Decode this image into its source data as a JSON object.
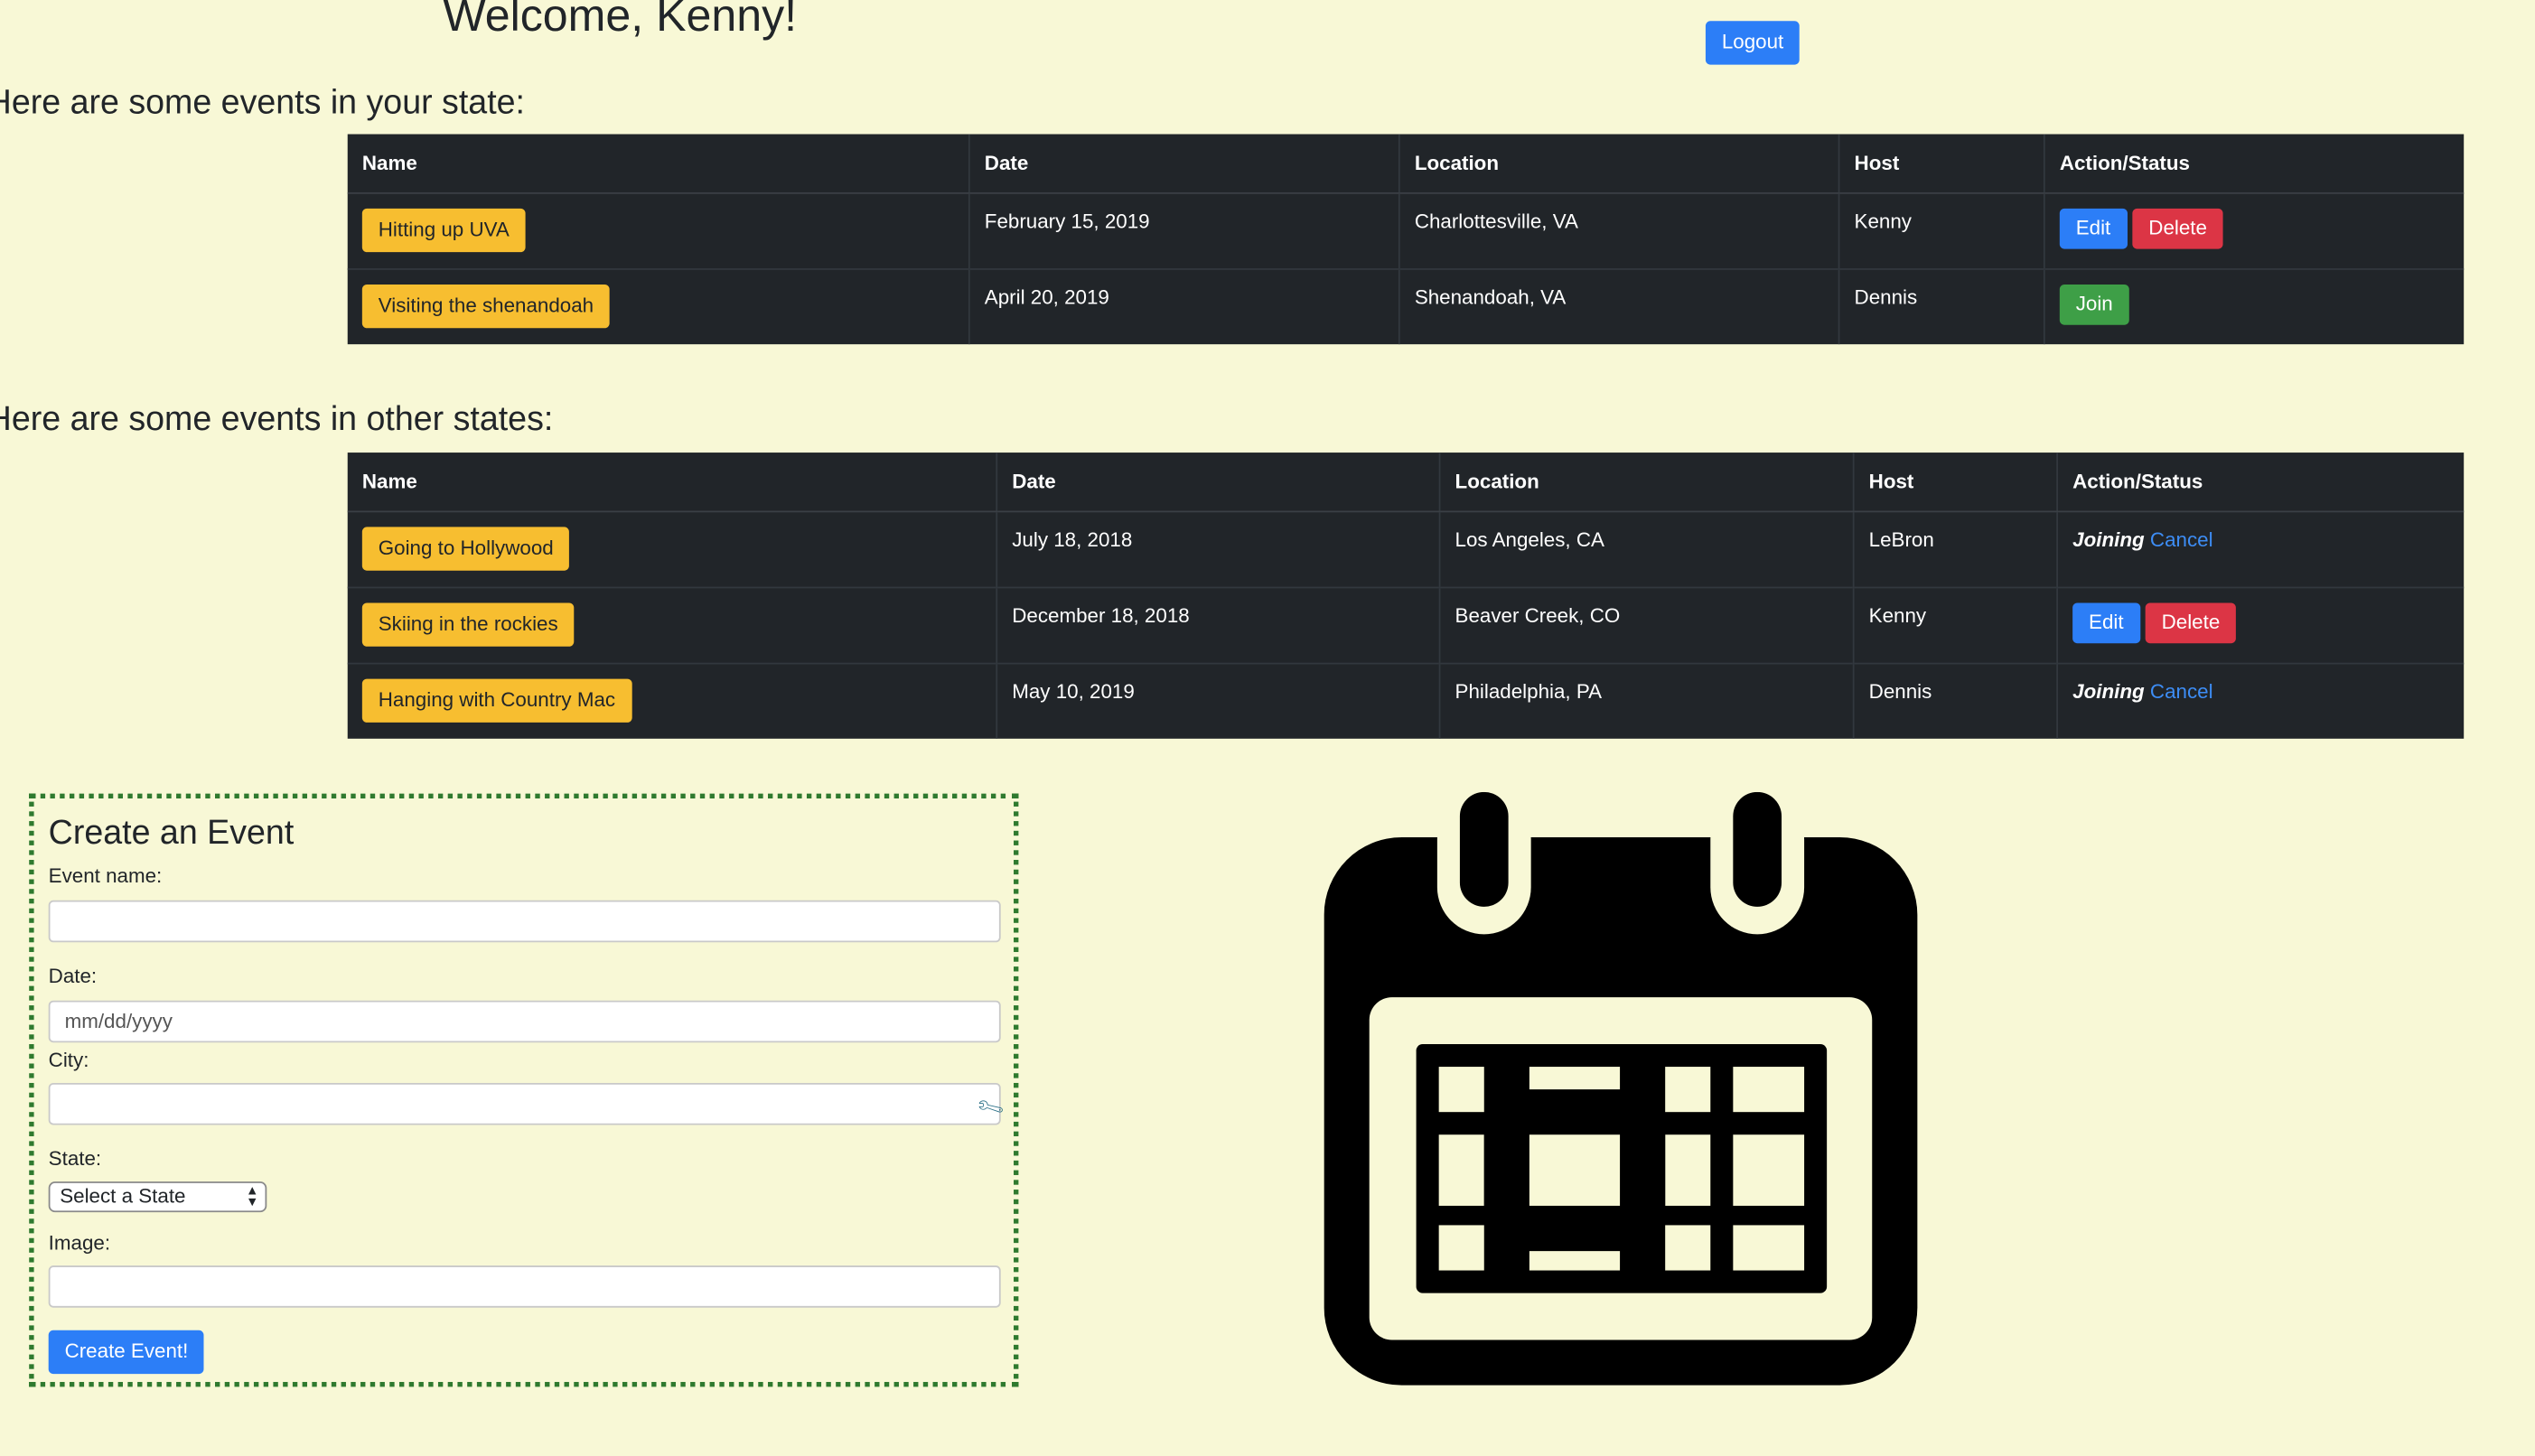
{
  "header": {
    "welcome": "Welcome, Kenny!",
    "logout_label": "Logout"
  },
  "your_state": {
    "heading": "Here are some events in your state:",
    "columns": [
      "Name",
      "Date",
      "Location",
      "Host",
      "Action/Status"
    ],
    "rows": [
      {
        "name": "Hitting up UVA",
        "date": "February 15, 2019",
        "location": "Charlottesville, VA",
        "host": "Kenny",
        "actions": {
          "edit": "Edit",
          "delete": "Delete"
        }
      },
      {
        "name": "Visiting the shenandoah",
        "date": "April 20, 2019",
        "location": "Shenandoah, VA",
        "host": "Dennis",
        "actions": {
          "join": "Join"
        }
      }
    ]
  },
  "other_states": {
    "heading": "Here are some events in other states:",
    "columns": [
      "Name",
      "Date",
      "Location",
      "Host",
      "Action/Status"
    ],
    "rows": [
      {
        "name": "Going to Hollywood",
        "date": "July 18, 2018",
        "location": "Los Angeles, CA",
        "host": "LeBron",
        "status": {
          "joining": "Joining",
          "cancel": "Cancel"
        }
      },
      {
        "name": "Skiing in the rockies",
        "date": "December 18, 2018",
        "location": "Beaver Creek, CO",
        "host": "Kenny",
        "actions": {
          "edit": "Edit",
          "delete": "Delete"
        }
      },
      {
        "name": "Hanging with Country Mac",
        "date": "May 10, 2019",
        "location": "Philadelphia, PA",
        "host": "Dennis",
        "status": {
          "joining": "Joining",
          "cancel": "Cancel"
        }
      }
    ]
  },
  "create_form": {
    "title": "Create an Event",
    "event_name_label": "Event name:",
    "event_name_value": "",
    "date_label": "Date:",
    "date_placeholder": "mm/dd/yyyy",
    "city_label": "City:",
    "city_value": "",
    "state_label": "State:",
    "state_selected": "Select a State",
    "image_label": "Image:",
    "image_value": "",
    "submit_label": "Create Event!"
  },
  "icons": {
    "calendar": "calendar-icon",
    "city_field": "wrench-icon",
    "select": "chevron-updown-icon"
  },
  "colors": {
    "background": "#f8f8d6",
    "table_bg": "#212529",
    "primary": "#2c7ef7",
    "danger": "#dc3545",
    "success": "#3e9f47",
    "warning": "#f7be30",
    "form_border": "#2f7a2f"
  }
}
